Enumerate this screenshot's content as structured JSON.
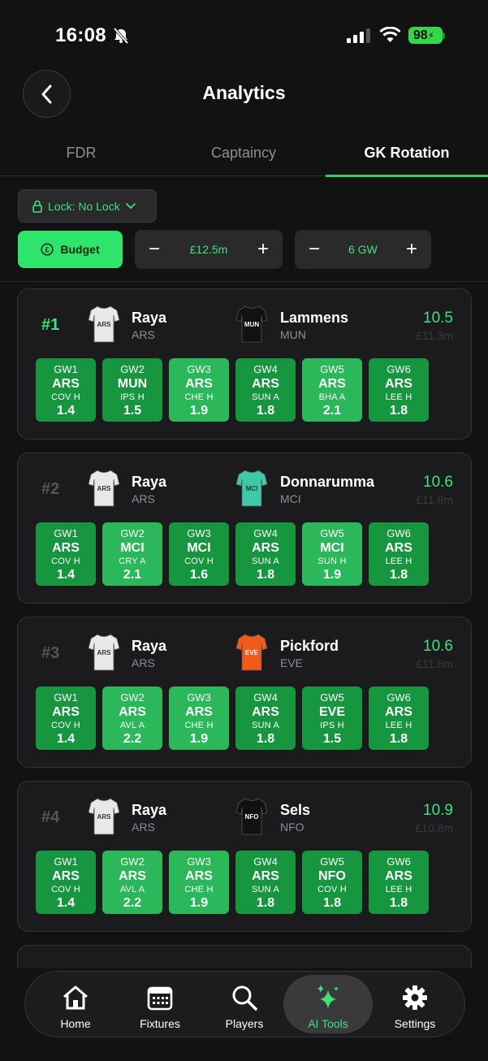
{
  "status": {
    "time": "16:08",
    "battery": "98"
  },
  "header": {
    "title": "Analytics"
  },
  "tabs": [
    {
      "label": "FDR"
    },
    {
      "label": "Captaincy"
    },
    {
      "label": "GK Rotation"
    }
  ],
  "controls": {
    "lock_label": "Lock: No Lock",
    "budget_label": "Budget",
    "budget_value": "£12.5m",
    "gw_value": "6 GW"
  },
  "pairs": [
    {
      "rank": "#1",
      "total": "10.5",
      "price": "£11.3m",
      "p1": {
        "name": "Raya",
        "team": "ARS",
        "kit": "ARS"
      },
      "p2": {
        "name": "Lammens",
        "team": "MUN",
        "kit": "MUN"
      },
      "gws": [
        {
          "gw": "GW1",
          "team": "ARS",
          "opp": "COV H",
          "val": "1.4"
        },
        {
          "gw": "GW2",
          "team": "MUN",
          "opp": "IPS H",
          "val": "1.5"
        },
        {
          "gw": "GW3",
          "team": "ARS",
          "opp": "CHE H",
          "val": "1.9"
        },
        {
          "gw": "GW4",
          "team": "ARS",
          "opp": "SUN A",
          "val": "1.8"
        },
        {
          "gw": "GW5",
          "team": "ARS",
          "opp": "BHA A",
          "val": "2.1"
        },
        {
          "gw": "GW6",
          "team": "ARS",
          "opp": "LEE H",
          "val": "1.8"
        }
      ]
    },
    {
      "rank": "#2",
      "total": "10.6",
      "price": "£11.8m",
      "p1": {
        "name": "Raya",
        "team": "ARS",
        "kit": "ARS"
      },
      "p2": {
        "name": "Donnarumma",
        "team": "MCI",
        "kit": "MCI"
      },
      "gws": [
        {
          "gw": "GW1",
          "team": "ARS",
          "opp": "COV H",
          "val": "1.4"
        },
        {
          "gw": "GW2",
          "team": "MCI",
          "opp": "CRY A",
          "val": "2.1"
        },
        {
          "gw": "GW3",
          "team": "MCI",
          "opp": "COV H",
          "val": "1.6"
        },
        {
          "gw": "GW4",
          "team": "ARS",
          "opp": "SUN A",
          "val": "1.8"
        },
        {
          "gw": "GW5",
          "team": "MCI",
          "opp": "SUN H",
          "val": "1.9"
        },
        {
          "gw": "GW6",
          "team": "ARS",
          "opp": "LEE H",
          "val": "1.8"
        }
      ]
    },
    {
      "rank": "#3",
      "total": "10.6",
      "price": "£11.8m",
      "p1": {
        "name": "Raya",
        "team": "ARS",
        "kit": "ARS"
      },
      "p2": {
        "name": "Pickford",
        "team": "EVE",
        "kit": "EVE"
      },
      "gws": [
        {
          "gw": "GW1",
          "team": "ARS",
          "opp": "COV H",
          "val": "1.4"
        },
        {
          "gw": "GW2",
          "team": "ARS",
          "opp": "AVL A",
          "val": "2.2"
        },
        {
          "gw": "GW3",
          "team": "ARS",
          "opp": "CHE H",
          "val": "1.9"
        },
        {
          "gw": "GW4",
          "team": "ARS",
          "opp": "SUN A",
          "val": "1.8"
        },
        {
          "gw": "GW5",
          "team": "EVE",
          "opp": "IPS H",
          "val": "1.5"
        },
        {
          "gw": "GW6",
          "team": "ARS",
          "opp": "LEE H",
          "val": "1.8"
        }
      ]
    },
    {
      "rank": "#4",
      "total": "10.9",
      "price": "£10.8m",
      "p1": {
        "name": "Raya",
        "team": "ARS",
        "kit": "ARS"
      },
      "p2": {
        "name": "Sels",
        "team": "NFO",
        "kit": "NFO"
      },
      "gws": [
        {
          "gw": "GW1",
          "team": "ARS",
          "opp": "COV H",
          "val": "1.4"
        },
        {
          "gw": "GW2",
          "team": "ARS",
          "opp": "AVL A",
          "val": "2.2"
        },
        {
          "gw": "GW3",
          "team": "ARS",
          "opp": "CHE H",
          "val": "1.9"
        },
        {
          "gw": "GW4",
          "team": "ARS",
          "opp": "SUN A",
          "val": "1.8"
        },
        {
          "gw": "GW5",
          "team": "NFO",
          "opp": "COV H",
          "val": "1.8"
        },
        {
          "gw": "GW6",
          "team": "ARS",
          "opp": "LEE H",
          "val": "1.8"
        }
      ]
    }
  ],
  "nav": [
    {
      "label": "Home",
      "icon": "home-icon"
    },
    {
      "label": "Fixtures",
      "icon": "calendar-icon"
    },
    {
      "label": "Players",
      "icon": "search-icon"
    },
    {
      "label": "AI Tools",
      "icon": "sparkles-icon"
    },
    {
      "label": "Settings",
      "icon": "gear-icon"
    }
  ],
  "colors": {
    "accent": "#2ee46a",
    "gw_dark": "#16963f",
    "gw_light": "#2bb85a",
    "background": "#121212"
  }
}
